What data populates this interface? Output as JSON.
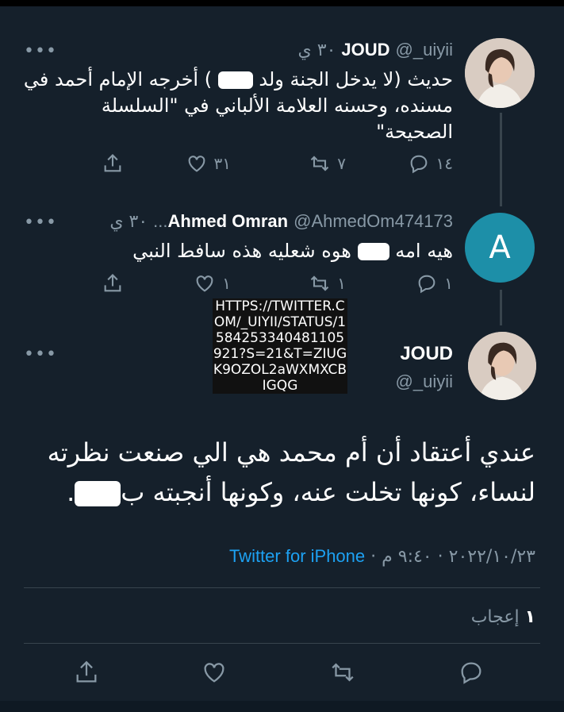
{
  "tweets": [
    {
      "name": "JOUD",
      "handle": "@_uiyii",
      "time": "٣٠ ي",
      "more": "•••",
      "text_before": "حديث (لا يدخل الجنة ولد",
      "text_after": ") أخرجه الإمام أحمد في مسنده، وحسنه العلامة الألباني في \"السلسلة الصحيحة\"",
      "replies": "١٤",
      "retweets": "٧",
      "likes": "٣١"
    },
    {
      "name": "Ahmed Omran",
      "handle": "@AhmedOm474173...",
      "time": "٣٠ ي",
      "more": "•••",
      "avatar_letter": "A",
      "text_before": "هيه امه",
      "text_after": "هوه شعليه هذه سافط النبي",
      "replies": "١",
      "retweets": "١",
      "likes": "١"
    }
  ],
  "url_overlay": "HTTPS://TWITTER.COM/_UIYII/STATUS/1584253340481105921?S=21&T=ZIUGK9OZOL2aWXMXCBIGQG",
  "main_tweet": {
    "name": "JOUD",
    "handle": "@_uiyii",
    "more": "•••",
    "text_before": "عندي أعتقاد أن أم محمد هي الي صنعت نظرته لنساء، كونها تخلت عنه، وكونها أنجبته ب",
    "text_after": ".",
    "date": "٢٠٢٢/١٠/٢٣",
    "time": "٩:٤٠ م",
    "separator": "·",
    "source": "Twitter for iPhone",
    "likes_count": "١",
    "likes_label": "إعجاب"
  },
  "icons": {
    "reply": "reply-icon",
    "retweet": "retweet-icon",
    "like": "heart-icon",
    "share": "share-icon"
  },
  "colors": {
    "background": "#15202b",
    "secondary_text": "#8899a6",
    "link": "#1da1f2",
    "avatar_a": "#1d8fa8"
  }
}
